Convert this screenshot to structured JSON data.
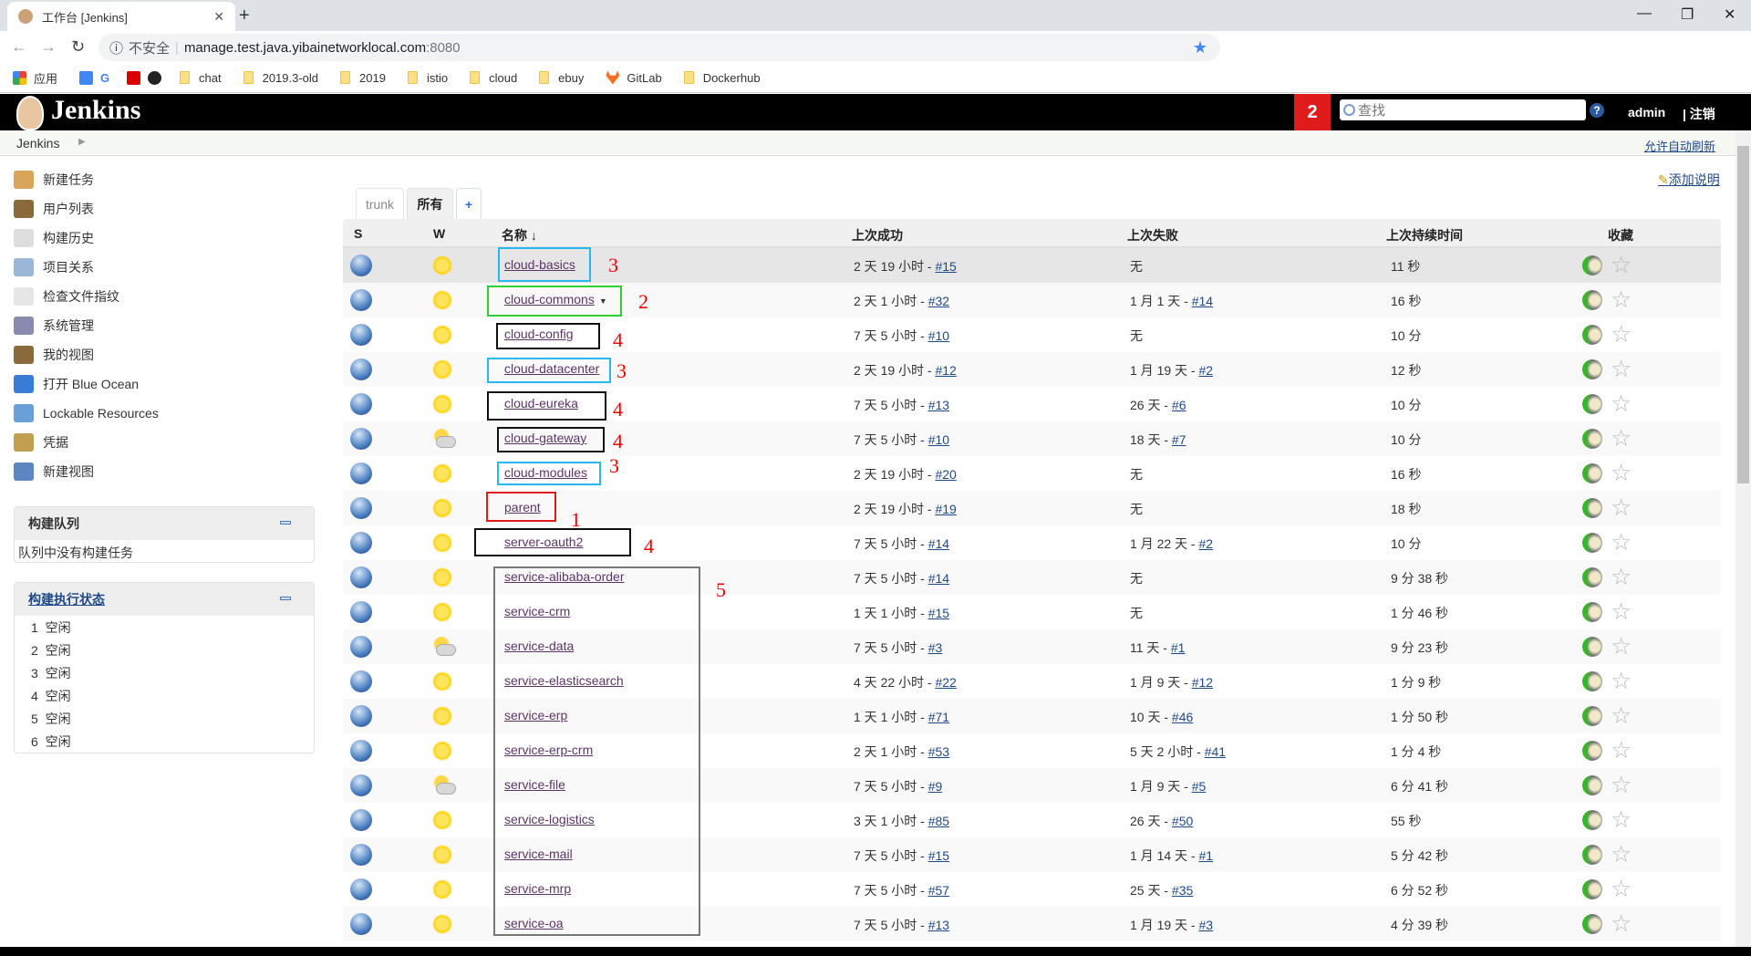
{
  "browser": {
    "tab_title": "工作台 [Jenkins]",
    "new_tab": "+",
    "security": "不安全",
    "url_host": "manage.test.java.yibainetworklocal.com",
    "url_port": ":8080",
    "bookmarks": [
      "应用",
      "chat",
      "2019.3-old",
      "2019",
      "istio",
      "cloud",
      "ebuy",
      "GitLab",
      "Dockerhub"
    ]
  },
  "header": {
    "brand": "Jenkins",
    "notification_count": "2",
    "search_placeholder": "查找",
    "help": "?",
    "user": "admin",
    "logout": "| 注销"
  },
  "breadcrumb": {
    "root": "Jenkins",
    "auto_refresh": "允许自动刷新"
  },
  "sidebar": {
    "items": [
      "新建任务",
      "用户列表",
      "构建历史",
      "项目关系",
      "检查文件指纹",
      "系统管理",
      "我的视图",
      "打开 Blue Ocean",
      "Lockable Resources",
      "凭据",
      "新建视图"
    ],
    "queue": {
      "title": "构建队列",
      "empty": "队列中没有构建任务"
    },
    "executors": {
      "title": "构建执行状态",
      "items": [
        {
          "num": "1",
          "status": "空闲"
        },
        {
          "num": "2",
          "status": "空闲"
        },
        {
          "num": "3",
          "status": "空闲"
        },
        {
          "num": "4",
          "status": "空闲"
        },
        {
          "num": "5",
          "status": "空闲"
        },
        {
          "num": "6",
          "status": "空闲"
        }
      ]
    }
  },
  "main": {
    "add_description": "添加说明",
    "view_tabs": [
      "trunk",
      "所有",
      "+"
    ],
    "active_tab": "所有",
    "columns": {
      "s": "S",
      "w": "W",
      "name": "名称 ↓",
      "last_success": "上次成功",
      "last_failure": "上次失败",
      "last_duration": "上次持续时间",
      "favorite": "收藏"
    },
    "jobs": [
      {
        "name": "cloud-basics",
        "weather": "sunny",
        "success": "2 天 19 小时 - ",
        "success_build": "#15",
        "failure": "无",
        "failure_build": "",
        "duration": "11 秒"
      },
      {
        "name": "cloud-commons",
        "weather": "sunny",
        "dropdown": true,
        "success": "2 天 1 小时 - ",
        "success_build": "#32",
        "failure": "1 月 1 天 - ",
        "failure_build": "#14",
        "duration": "16 秒"
      },
      {
        "name": "cloud-config",
        "weather": "sunny",
        "success": "7 天 5 小时 - ",
        "success_build": "#10",
        "failure": "无",
        "failure_build": "",
        "duration": "10 分"
      },
      {
        "name": "cloud-datacenter",
        "weather": "sunny",
        "success": "2 天 19 小时 - ",
        "success_build": "#12",
        "failure": "1 月 19 天 - ",
        "failure_build": "#2",
        "duration": "12 秒"
      },
      {
        "name": "cloud-eureka",
        "weather": "sunny",
        "success": "7 天 5 小时 - ",
        "success_build": "#13",
        "failure": "26 天 - ",
        "failure_build": "#6",
        "duration": "10 分"
      },
      {
        "name": "cloud-gateway",
        "weather": "cloudy",
        "success": "7 天 5 小时 - ",
        "success_build": "#10",
        "failure": "18 天 - ",
        "failure_build": "#7",
        "duration": "10 分"
      },
      {
        "name": "cloud-modules",
        "weather": "sunny",
        "success": "2 天 19 小时 - ",
        "success_build": "#20",
        "failure": "无",
        "failure_build": "",
        "duration": "16 秒"
      },
      {
        "name": "parent",
        "weather": "sunny",
        "success": "2 天 19 小时 - ",
        "success_build": "#19",
        "failure": "无",
        "failure_build": "",
        "duration": "18 秒"
      },
      {
        "name": "server-oauth2",
        "weather": "sunny",
        "success": "7 天 5 小时 - ",
        "success_build": "#14",
        "failure": "1 月 22 天 - ",
        "failure_build": "#2",
        "duration": "10 分"
      },
      {
        "name": "service-alibaba-order",
        "weather": "sunny",
        "success": "7 天 5 小时 - ",
        "success_build": "#14",
        "failure": "无",
        "failure_build": "",
        "duration": "9 分 38 秒"
      },
      {
        "name": "service-crm",
        "weather": "sunny",
        "success": "1 天 1 小时 - ",
        "success_build": "#15",
        "failure": "无",
        "failure_build": "",
        "duration": "1 分 46 秒"
      },
      {
        "name": "service-data",
        "weather": "cloudy",
        "success": "7 天 5 小时 - ",
        "success_build": "#3",
        "failure": "11 天 - ",
        "failure_build": "#1",
        "duration": "9 分 23 秒"
      },
      {
        "name": "service-elasticsearch",
        "weather": "sunny",
        "success": "4 天 22 小时 - ",
        "success_build": "#22",
        "failure": "1 月 9 天 - ",
        "failure_build": "#12",
        "duration": "1 分 9 秒"
      },
      {
        "name": "service-erp",
        "weather": "sunny",
        "success": "1 天 1 小时 - ",
        "success_build": "#71",
        "failure": "10 天 - ",
        "failure_build": "#46",
        "duration": "1 分 50 秒"
      },
      {
        "name": "service-erp-crm",
        "weather": "sunny",
        "success": "2 天 1 小时 - ",
        "success_build": "#53",
        "failure": "5 天 2 小时 - ",
        "failure_build": "#41",
        "duration": "1 分 4 秒"
      },
      {
        "name": "service-file",
        "weather": "cloudy",
        "success": "7 天 5 小时 - ",
        "success_build": "#9",
        "failure": "1 月 9 天 - ",
        "failure_build": "#5",
        "duration": "6 分 41 秒"
      },
      {
        "name": "service-logistics",
        "weather": "sunny",
        "success": "3 天 1 小时 - ",
        "success_build": "#85",
        "failure": "26 天 - ",
        "failure_build": "#50",
        "duration": "55 秒"
      },
      {
        "name": "service-mail",
        "weather": "sunny",
        "success": "7 天 5 小时 - ",
        "success_build": "#15",
        "failure": "1 月 14 天 - ",
        "failure_build": "#1",
        "duration": "5 分 42 秒"
      },
      {
        "name": "service-mrp",
        "weather": "sunny",
        "success": "7 天 5 小时 - ",
        "success_build": "#57",
        "failure": "25 天 - ",
        "failure_build": "#35",
        "duration": "6 分 52 秒"
      },
      {
        "name": "service-oa",
        "weather": "sunny",
        "success": "7 天 5 小时 - ",
        "success_build": "#13",
        "failure": "1 月 19 天 - ",
        "failure_build": "#3",
        "duration": "4 分 39 秒"
      }
    ]
  },
  "annotations": {
    "labels": [
      "3",
      "2",
      "4",
      "3",
      "4",
      "4",
      "3",
      "1",
      "4",
      "5"
    ],
    "colors": {
      "blue": "#2ab7ee",
      "green": "#33cc33",
      "black": "#111111",
      "red": "#e01b1b",
      "gray": "#777777"
    }
  }
}
